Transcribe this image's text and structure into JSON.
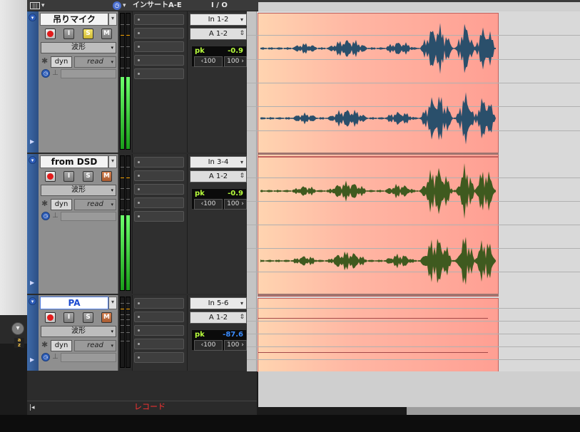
{
  "header": {
    "inserts_label": "インサートA-E",
    "io_label": "I / O"
  },
  "tracks": [
    {
      "name": "吊りマイク",
      "name_selected": false,
      "rec": "",
      "input": "I",
      "solo": "S",
      "mute": "M",
      "view": "波形",
      "dyn": "dyn",
      "automation": "read",
      "io_in": "In 1-2",
      "io_out": "A 1-2",
      "pk_label": "pk",
      "pk_value": "-0.9",
      "pan_left": "‹100",
      "pan_right": "100 ›",
      "meter_left_level": 0.53,
      "meter_right_level": 0.53,
      "solo_active": true,
      "mute_alt": false,
      "audio": true
    },
    {
      "name": "from DSD",
      "name_selected": false,
      "rec": "",
      "input": "I",
      "solo": "S",
      "mute": "M",
      "view": "波形",
      "dyn": "dyn",
      "automation": "read",
      "io_in": "In 3-4",
      "io_out": "A 1-2",
      "pk_label": "pk",
      "pk_value": "-0.9",
      "pan_left": "‹100",
      "pan_right": "100 ›",
      "meter_left_level": 0.56,
      "meter_right_level": 0.56,
      "solo_active": false,
      "mute_alt": true,
      "audio": true
    },
    {
      "name": "PA",
      "name_selected": true,
      "rec": "",
      "input": "I",
      "solo": "S",
      "mute": "M",
      "view": "波形",
      "dyn": "dyn",
      "automation": "read",
      "io_in": "In 5-6",
      "io_out": "A 1-2",
      "pk_label": "pk",
      "pk_value": "-87.6",
      "pan_left": "‹100",
      "pan_right": "100 ›",
      "meter_left_level": 0.0,
      "meter_right_level": 0.0,
      "solo_active": false,
      "mute_alt": true,
      "audio": false
    }
  ],
  "bottom": {
    "record_label": "レコード"
  },
  "colors": {
    "track_select_blue": "#3e6aa8",
    "meter_green": "#2bd42b",
    "clip_red": "#ff9f93",
    "wave_blue": "#2a4f6b",
    "wave_green": "#3f5a1f",
    "pk_text": "#b8ff3c",
    "pk_text_low": "#3a8cff",
    "record_red": "#ff3232"
  }
}
